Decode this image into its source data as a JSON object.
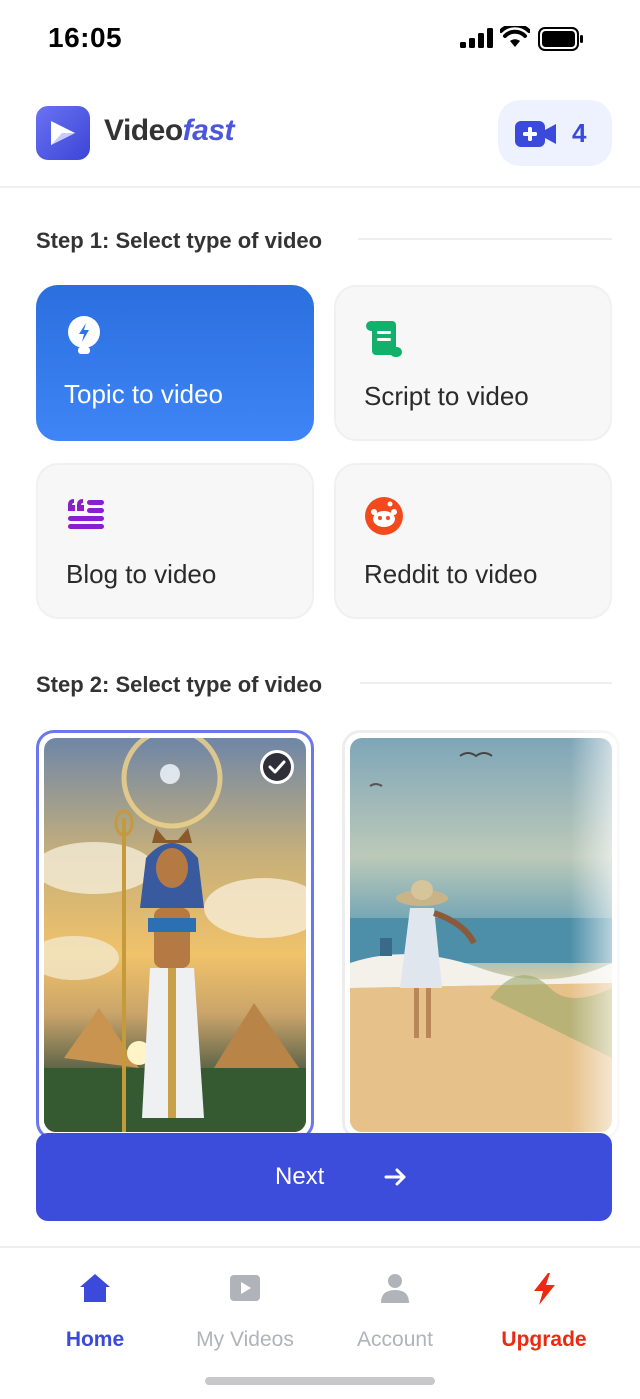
{
  "status_bar": {
    "time": "16:05"
  },
  "header": {
    "brand_part1": "Video",
    "brand_part2": "fast",
    "credits_count": "4",
    "icons": {
      "logo": "play-logo-icon",
      "credits": "video-camera-plus-icon"
    }
  },
  "step1": {
    "title": "Step 1: Select type of video",
    "options": [
      {
        "label": "Topic to video",
        "icon": "lightbulb-icon",
        "selected": true
      },
      {
        "label": "Script to video",
        "icon": "scroll-icon",
        "selected": false
      },
      {
        "label": "Blog to video",
        "icon": "quote-lines-icon",
        "selected": false
      },
      {
        "label": "Reddit to video",
        "icon": "reddit-icon",
        "selected": false
      }
    ]
  },
  "step2": {
    "title": "Step 2: Select type of video",
    "templates": [
      {
        "name": "egyptian-cat-pharaoh",
        "selected": true
      },
      {
        "name": "woman-on-beach",
        "selected": false
      }
    ]
  },
  "next_button": {
    "label": "Next",
    "icon": "arrow-right-icon"
  },
  "bottom_nav": [
    {
      "label": "Home",
      "icon": "home-icon",
      "active": true
    },
    {
      "label": "My Videos",
      "icon": "video-play-icon",
      "active": false
    },
    {
      "label": "Account",
      "icon": "user-icon",
      "active": false
    },
    {
      "label": "Upgrade",
      "icon": "lightning-icon",
      "active": false
    }
  ],
  "colors": {
    "primary": "#3c4adb",
    "card_active": "#3077e8",
    "upgrade": "#ea2a12",
    "script_icon": "#13b06b",
    "blog_icon": "#8b1fd0",
    "reddit_icon": "#f24a1d"
  }
}
